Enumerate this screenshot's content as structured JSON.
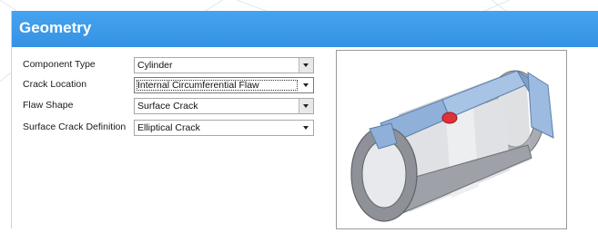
{
  "panel": {
    "title": "Geometry"
  },
  "fields": [
    {
      "label": "Component Type",
      "value": "Cylinder"
    },
    {
      "label": "Crack Location",
      "value": "Internal Circumferential Flaw"
    },
    {
      "label": "Flaw Shape",
      "value": "Surface Crack"
    },
    {
      "label": "Surface Crack Definition",
      "value": "Elliptical Crack"
    }
  ],
  "colors": {
    "header": "#3a9aea",
    "cylinder_outer": "#9a9da3",
    "cylinder_blue": "#8fb0d8",
    "flaw": "#e0303a"
  },
  "icons": {
    "dropdown": "chevron-down-icon",
    "illustration": "cylinder-crack-illustration"
  }
}
